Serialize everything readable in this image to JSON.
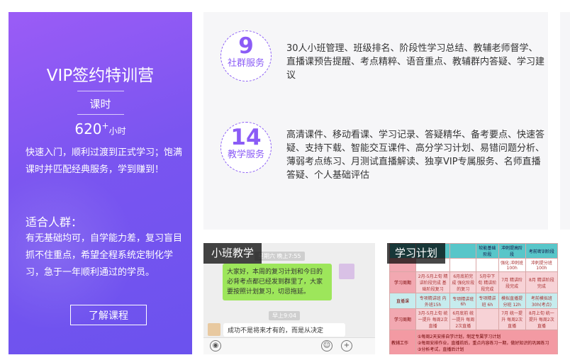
{
  "promo": {
    "title": "VIP签约特训营",
    "subtitle": "课时",
    "hours_value": "620",
    "hours_plus": "+",
    "hours_unit": "小时",
    "description": "快速入门，顺利过渡到正式学习；饱满课时并匹配经典服务，学到赚到！",
    "audience_title": "适合人群：",
    "audience_desc": "有无基础均可，自学能力差，复习盲目抓不住重点，希望全程系统定制化学习，急于一年顺利通过的学员。",
    "cta_label": "了解课程"
  },
  "services": [
    {
      "count": "9",
      "label": "社群服务",
      "text": "30人小班管理、班级排名、阶段性学习总结、教辅老师督学、直播课预告提醒、考点精粹、语音重点、教辅群内答疑、学习建议"
    },
    {
      "count": "14",
      "label": "教学服务",
      "text": "高清课件、移动看课、学习记录、答疑精华、备考要点、快速答疑、支持下载、智能交互课件、高分学习计划、易错问题分析、薄弱考点练习、月测试直播解读、独享VIP专属服务、名师直播答疑、个人基础评估"
    }
  ],
  "chat_panel": {
    "label": "小班教学",
    "timestamp_1": "星期六 晚上7:55",
    "message_1": "大家好，本周的复习计划和今日的必背考点都已经发到群里了，大家要按照计划复习，切忌拖延。",
    "timestamp_2": "早上9:04",
    "message_2": "成功不是将来才有的，而是从决定"
  },
  "plan_panel": {
    "label": "学习计划",
    "header": [
      "",
      "",
      "",
      "较能基础阶段",
      "冲刺提高阶段",
      "考前密训阶段"
    ],
    "rows": [
      {
        "head": "",
        "cells": [
          "",
          "",
          "",
          "强化:冲刺班100h",
          "冲刺提分班100h",
          "应试规划班8h"
        ]
      },
      {
        "head": "学习周期",
        "cells": [
          "2月-5月上旬 精讲阶段完成 基础阶段复习",
          "6月底前完成 强化阶段的复习",
          "5月中下旬 精讲阶段完成",
          "7月 精讲阶段完成",
          "8月 精讲阶段完成",
          ""
        ]
      },
      {
        "head": "直播课",
        "cells": [
          "专项精讲班 内外班15h",
          "专项精讲班 6h",
          "专项精讲班 6h",
          "模拟直播提分班 12h",
          "考前模拟班 30h(考点)",
          "考前密训班 24h"
        ]
      },
      {
        "head": "学习周期",
        "cells": [
          "3月-5月上旬 统一提升 每周2次直播",
          "6月底前 统一提升 每周2次直播",
          "",
          "7月 统一提升 每周2次直播",
          "8月上旬 统一提升 每周2次直播",
          ""
        ]
      },
      {
        "head": "教辅工作",
        "cells": [
          "①每周2天安排自学计划，制定专属学习计划",
          "②每周安排作业，直播前后，重点内容练习一期，做好知识的巩固练习",
          "③分析考试，直播后计划",
          "",
          "",
          ""
        ]
      }
    ]
  }
}
